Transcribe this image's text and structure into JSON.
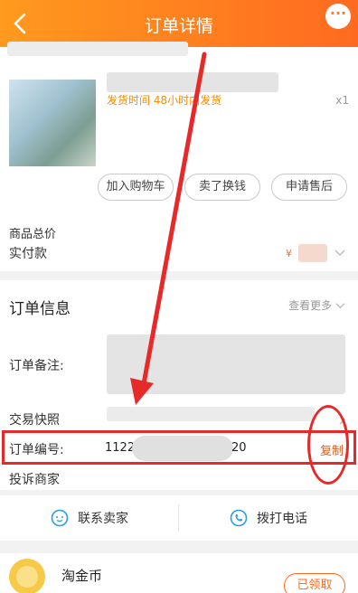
{
  "header": {
    "title": "订单详情",
    "more_label": "···"
  },
  "product": {
    "ship_info": "发货时间  48小时内发货",
    "quantity": "x1",
    "buttons": [
      "加入购物车",
      "卖了换钱",
      "申请售后"
    ]
  },
  "summary": {
    "total_label": "商品总价",
    "paid_label": "实付款",
    "currency_symbol": "¥"
  },
  "order_info": {
    "title": "订单信息",
    "more_link": "查看更多",
    "remark_label": "订单备注:",
    "snapshot_label": "交易快照",
    "order_no_label": "订单编号:",
    "order_no_prefix": "1122",
    "order_no_suffix": "20",
    "copy_label": "复制",
    "complaint_label": "投诉商家"
  },
  "actions": {
    "contact_seller": "联系卖家",
    "call": "拨打电话"
  },
  "coins": {
    "label": "淘金币",
    "status": "已领取"
  },
  "colors": {
    "brand_orange": "#ff6a20",
    "highlight_red": "#e62a2a"
  }
}
